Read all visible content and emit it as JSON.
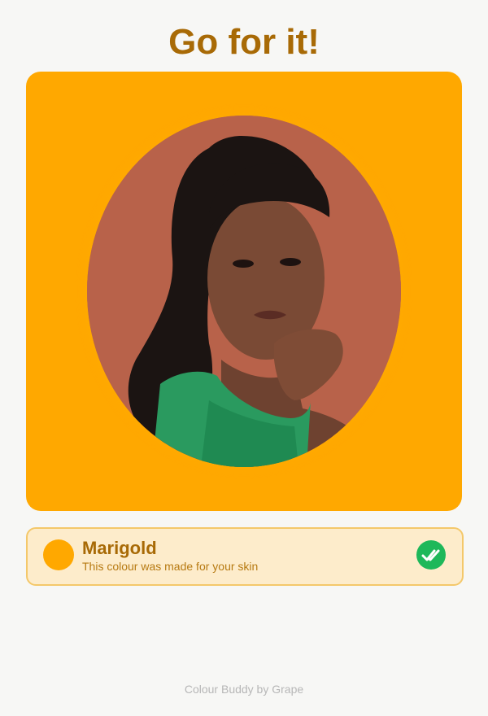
{
  "header": {
    "title": "Go for it!"
  },
  "preview": {
    "background_color": "#ffa800",
    "portrait_icon": "person-photo"
  },
  "result": {
    "colour_name": "Marigold",
    "caption": "This colour was made for your skin",
    "swatch_color": "#ffa800",
    "verdict_icon": "double-check-icon",
    "verdict_color": "#1eb85a"
  },
  "footer": {
    "credit": "Colour Buddy by Grape"
  },
  "colors": {
    "accent_text": "#a86a06",
    "card_background": "#fdeccb",
    "card_border": "#f4c86a"
  }
}
